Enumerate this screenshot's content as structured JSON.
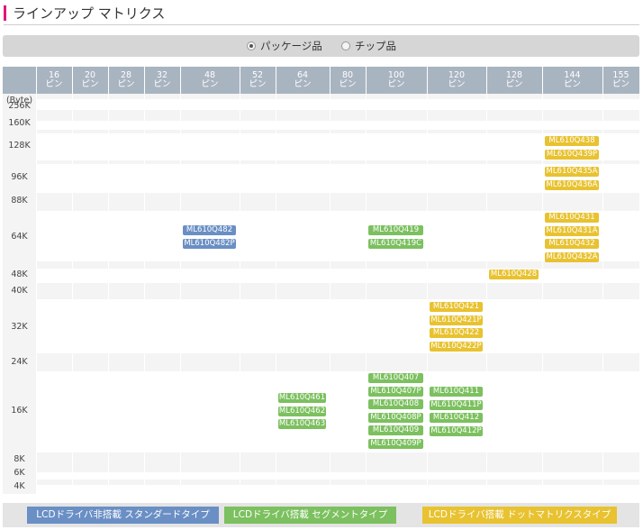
{
  "title": "ラインアップ マトリクス",
  "filter": {
    "options": [
      {
        "label": "パッケージ品",
        "checked": true
      },
      {
        "label": "チップ品",
        "checked": false
      }
    ]
  },
  "matrix": {
    "corner_label": "(Byte)",
    "unit": "ピン",
    "pin_columns": [
      "16",
      "20",
      "28",
      "32",
      "48",
      "52",
      "64",
      "80",
      "100",
      "120",
      "128",
      "144",
      "155"
    ],
    "memory_rows": [
      "256K",
      "160K",
      "128K",
      "96K",
      "88K",
      "64K",
      "48K",
      "40K",
      "32K",
      "24K",
      "16K",
      "8K",
      "6K",
      "4K"
    ],
    "entries": [
      {
        "pin": "48",
        "memory": "64K",
        "type": "standard",
        "parts": [
          "ML610Q482",
          "ML610Q482P"
        ]
      },
      {
        "pin": "100",
        "memory": "64K",
        "type": "segment",
        "parts": [
          "ML610Q419",
          "ML610Q419C"
        ]
      },
      {
        "pin": "144",
        "memory": "128K",
        "type": "dot_matrix",
        "parts": [
          "ML610Q438",
          "ML610Q439P"
        ]
      },
      {
        "pin": "144",
        "memory": "96K",
        "type": "dot_matrix",
        "parts": [
          "ML610Q435A",
          "ML610Q436A"
        ]
      },
      {
        "pin": "144",
        "memory": "64K",
        "type": "dot_matrix",
        "parts": [
          "ML610Q431",
          "ML610Q431A",
          "ML610Q432",
          "ML610Q432A"
        ]
      },
      {
        "pin": "128",
        "memory": "48K",
        "type": "dot_matrix",
        "parts": [
          "ML610Q428"
        ]
      },
      {
        "pin": "120",
        "memory": "32K",
        "type": "dot_matrix",
        "parts": [
          "ML610Q421",
          "ML610Q421P",
          "ML610Q422",
          "ML610Q422P"
        ]
      },
      {
        "pin": "64",
        "memory": "16K",
        "type": "segment",
        "parts": [
          "ML610Q461",
          "ML610Q462",
          "ML610Q463"
        ]
      },
      {
        "pin": "100",
        "memory": "16K",
        "type": "segment",
        "parts": [
          "ML610Q407",
          "ML610Q407P",
          "ML610Q408",
          "ML610Q408P",
          "ML610Q409",
          "ML610Q409P"
        ]
      },
      {
        "pin": "120",
        "memory": "16K",
        "type": "segment",
        "parts": [
          "ML610Q411",
          "ML610Q411P",
          "ML610Q412",
          "ML610Q412P"
        ]
      }
    ]
  },
  "legend": [
    {
      "key": "standard",
      "label": "LCDドライバ非搭載 スタンダードタイプ",
      "color": "#6a8fc4"
    },
    {
      "key": "segment",
      "label": "LCDドライバ搭載 セグメントタイプ",
      "color": "#7cc05f"
    },
    {
      "key": "dot_matrix",
      "label": "LCDドライバ搭載 ドットマトリクスタイプ",
      "color": "#e8c230"
    }
  ]
}
